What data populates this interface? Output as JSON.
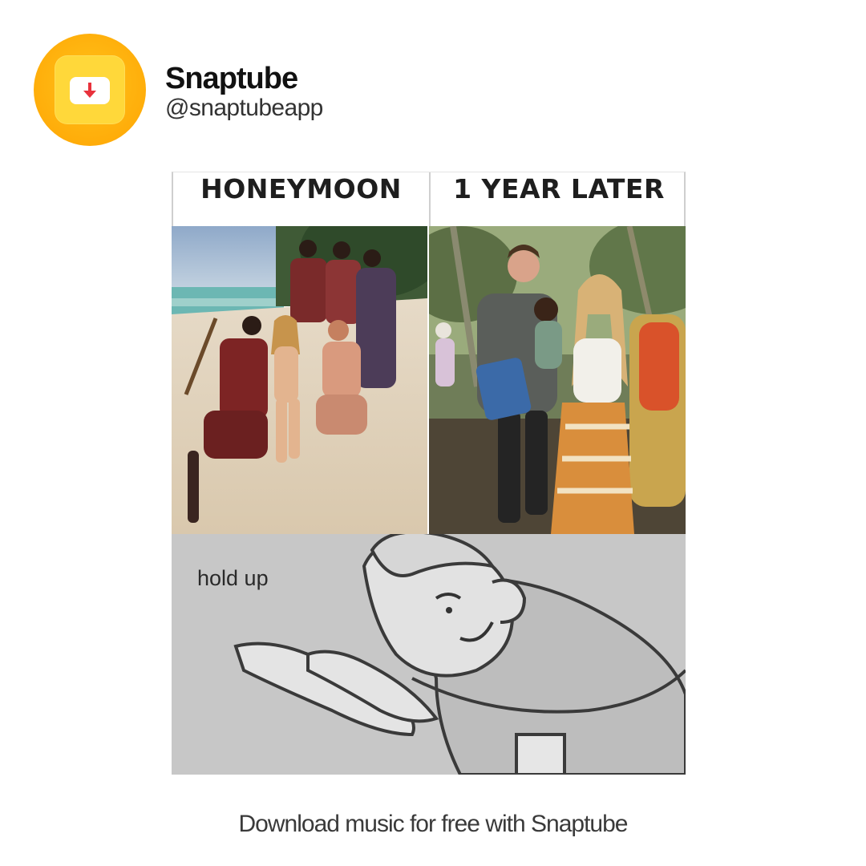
{
  "header": {
    "brand_name": "Snaptube",
    "handle": "@snaptubeapp",
    "logo_icon": "download-arrow-icon",
    "colors": {
      "logo_ring": "#ffad0a",
      "logo_tile": "#ffd83a",
      "arrow": "#e8323c"
    }
  },
  "meme": {
    "left_caption": "HONEYMOON",
    "right_caption": "1 YEAR LATER",
    "bottom_text": "hold up"
  },
  "footer": {
    "text": "Download music for free with Snaptube"
  }
}
